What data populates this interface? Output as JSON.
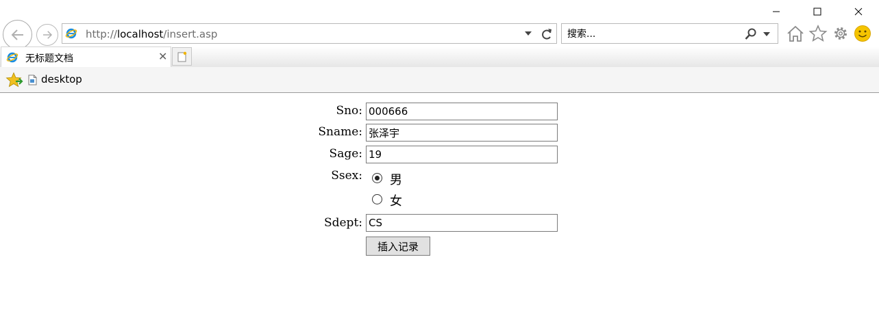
{
  "browser": {
    "address": {
      "prefix": "http://",
      "host": "localhost",
      "path": "/insert.asp"
    },
    "search": {
      "placeholder": "搜索..."
    },
    "tab": {
      "title": "无标题文档",
      "close_glyph": "✕"
    },
    "favorites": [
      {
        "label": "desktop"
      }
    ],
    "icons": [
      "back-icon",
      "forward-icon",
      "ie-icon",
      "dropdown-icon",
      "refresh-icon",
      "search-icon",
      "home-icon",
      "star-icon",
      "gear-icon",
      "smiley-icon",
      "new-tab-icon",
      "favorites-star-icon",
      "page-icon"
    ]
  },
  "form": {
    "sno": {
      "label": "Sno:",
      "value": "000666"
    },
    "sname": {
      "label": "Sname:",
      "value": "张泽宇"
    },
    "sage": {
      "label": "Sage:",
      "value": "19"
    },
    "ssex": {
      "label": "Ssex:",
      "options": [
        {
          "label": "男",
          "checked": true
        },
        {
          "label": "女",
          "checked": false
        }
      ]
    },
    "sdept": {
      "label": "Sdept:",
      "value": "CS"
    },
    "submit_label": "插入记录"
  },
  "colors": {
    "ie_blue": "#1a8de0",
    "ie_gold": "#f2b600",
    "smiley_yellow": "#f5c400",
    "fav_star": "#f0c020"
  }
}
